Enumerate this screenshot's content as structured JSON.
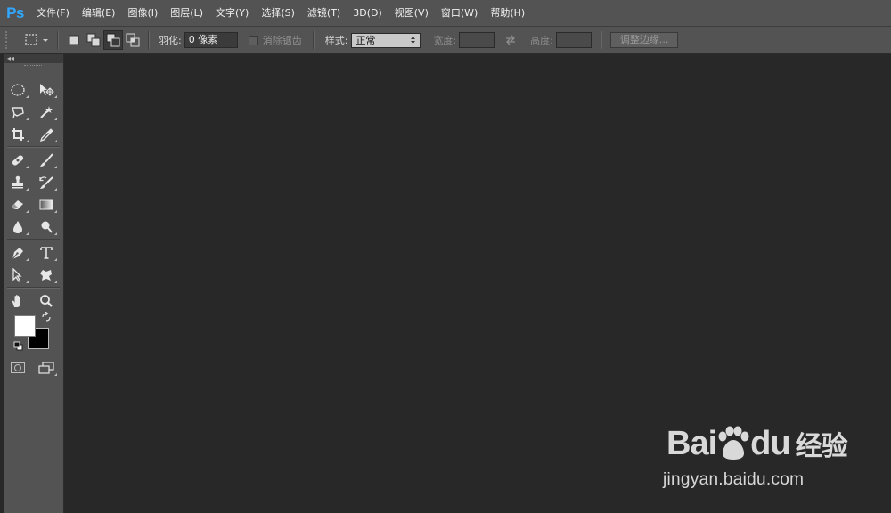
{
  "app": {
    "logo": "Ps"
  },
  "menu": [
    "文件(F)",
    "编辑(E)",
    "图像(I)",
    "图层(L)",
    "文字(Y)",
    "选择(S)",
    "滤镜(T)",
    "3D(D)",
    "视图(V)",
    "窗口(W)",
    "帮助(H)"
  ],
  "options": {
    "feather_label": "羽化:",
    "feather_value": "0 像素",
    "antialias_label": "消除锯齿",
    "style_label": "样式:",
    "style_value": "正常",
    "width_label": "宽度:",
    "height_label": "高度:",
    "refine_edge_button": "调整边缘..."
  },
  "toolbar": {
    "tools": [
      [
        "elliptical-marquee-icon",
        "move-icon"
      ],
      [
        "polygonal-lasso-icon",
        "magic-wand-icon"
      ],
      [
        "crop-icon",
        "eyedropper-icon"
      ],
      [
        "spot-healing-brush-icon",
        "brush-icon"
      ],
      [
        "clone-stamp-icon",
        "history-brush-icon"
      ],
      [
        "eraser-icon",
        "gradient-icon"
      ],
      [
        "blur-icon",
        "dodge-icon"
      ],
      [
        "pen-icon",
        "type-icon"
      ],
      [
        "path-selection-icon",
        "custom-shape-icon"
      ],
      [
        "hand-icon",
        "zoom-icon"
      ]
    ],
    "foreground_color": "#ffffff",
    "background_color": "#000000"
  },
  "watermark": {
    "brand": "Bai",
    "brand_suffix": "du",
    "product": "经验",
    "url": "jingyan.baidu.com"
  },
  "colors": {
    "chrome": "#535353",
    "workspace": "#282828",
    "logo": "#31a8ff"
  }
}
